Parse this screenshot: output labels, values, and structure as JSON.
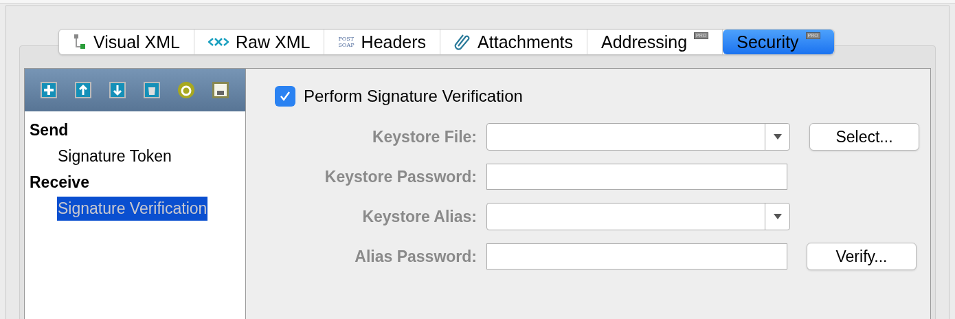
{
  "tabs": [
    {
      "label": "Visual XML",
      "kind": "tree",
      "selected": false
    },
    {
      "label": "Raw XML",
      "kind": "code",
      "selected": false
    },
    {
      "label": "Headers",
      "kind": "post",
      "icon_text": [
        "POST",
        "SOAP"
      ],
      "selected": false
    },
    {
      "label": "Attachments",
      "kind": "clip",
      "selected": false
    },
    {
      "label": "Addressing",
      "badge": "PRO",
      "selected": false
    },
    {
      "label": "Security",
      "badge": "PRO",
      "selected": true
    }
  ],
  "toolbar": [
    {
      "kind": "add"
    },
    {
      "kind": "up"
    },
    {
      "kind": "down"
    },
    {
      "kind": "delete"
    },
    {
      "kind": "refresh"
    },
    {
      "kind": "save"
    }
  ],
  "tree": [
    {
      "label": "Send",
      "children": [
        {
          "label": "Signature Token",
          "selected": false
        }
      ]
    },
    {
      "label": "Receive",
      "children": [
        {
          "label": "Signature Verification",
          "selected": true
        }
      ]
    }
  ],
  "verify_checkbox": {
    "label": "Perform Signature Verification",
    "checked": true
  },
  "fields": [
    {
      "label": "Keystore File:",
      "kind": "combo",
      "button": "Select..."
    },
    {
      "label": "Keystore Password:",
      "kind": "text"
    },
    {
      "label": "Keystore Alias:",
      "kind": "combo"
    },
    {
      "label": "Alias Password:",
      "kind": "text",
      "button": "Verify..."
    }
  ]
}
